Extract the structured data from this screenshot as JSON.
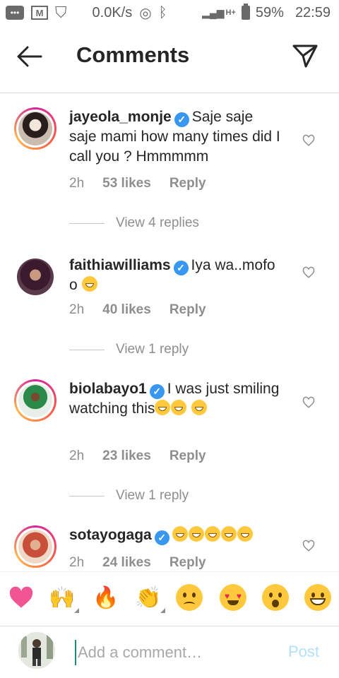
{
  "status_bar": {
    "net_speed": "0.0K/s",
    "network": "H+",
    "battery": "59%",
    "time": "22:59"
  },
  "header": {
    "title": "Comments"
  },
  "comments": [
    {
      "username": "jayeola_monje",
      "text": "Saje saje saje mami how many times did I call you ? Hmmmmm",
      "emoji_count": 0,
      "time": "2h",
      "likes": "53 likes",
      "reply": "Reply",
      "view_replies": "View 4 replies",
      "verified": true,
      "story_ring": true
    },
    {
      "username": "faithiawilliams",
      "text": "Iya wa..mofo o",
      "emoji_count": 1,
      "time": "2h",
      "likes": "40 likes",
      "reply": "Reply",
      "view_replies": "View 1 reply",
      "verified": true,
      "story_ring": false
    },
    {
      "username": "biolabayo1",
      "text": "I was just smiling watching this",
      "emoji_count": 3,
      "time": "2h",
      "likes": "23 likes",
      "reply": "Reply",
      "view_replies": "View 1 reply",
      "verified": true,
      "story_ring": true
    },
    {
      "username": "sotayogaga",
      "text": "",
      "emoji_count": 5,
      "time": "2h",
      "likes": "24 likes",
      "reply": "Reply",
      "verified": true,
      "story_ring": true
    }
  ],
  "emoji_bar": [
    "heart-icon",
    "raised-hands-icon",
    "fire-icon",
    "clapping-hands-icon",
    "crying-face-icon",
    "heart-eyes-icon",
    "surprised-face-icon",
    "grinning-face-icon"
  ],
  "comment_input": {
    "placeholder": "Add a comment…",
    "post_label": "Post"
  },
  "colors": {
    "verified_blue": "#3897f0",
    "post_disabled": "#b2dffc",
    "secondary_text": "#8e8e8e",
    "primary_text": "#262626"
  }
}
